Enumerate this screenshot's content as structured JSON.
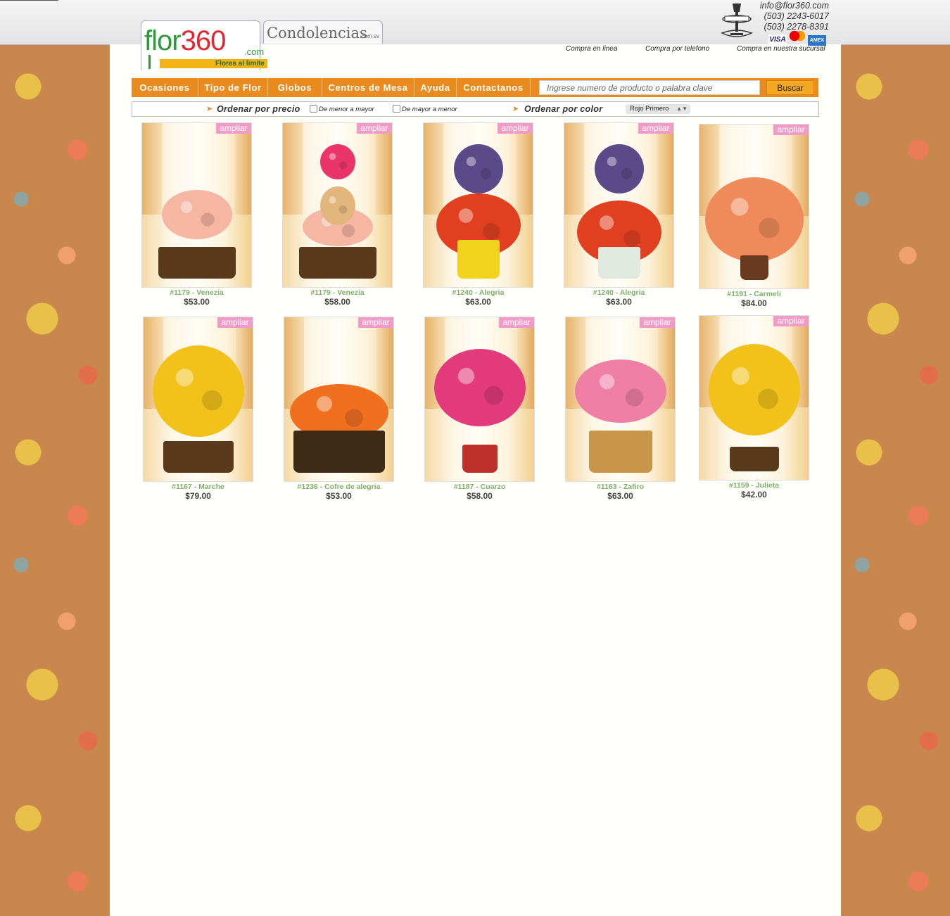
{
  "header": {
    "logo": {
      "brand_part1": "flor",
      "brand_part2": "360",
      "domain": ".com",
      "tagline": "Flores al limite"
    },
    "condolencias": {
      "name": "Condolencias",
      "domain": ".com.sv"
    },
    "contact": {
      "email": "info@flor360.com",
      "phone1": "(503) 2243-6017",
      "phone2": "(503) 2278-8391"
    },
    "cards": [
      "VISA",
      "MasterCard",
      "AMEX"
    ],
    "store_logo_icon": "la-gran-via-lamp-icon",
    "buy_links": [
      "Compra en linea",
      "Compra por telefono",
      "Compra en nuestra sucursal"
    ]
  },
  "nav": {
    "items": [
      "Ocasiones",
      "Tipo de Flor",
      "Globos",
      "Centros de Mesa",
      "Ayuda",
      "Contactanos"
    ],
    "search_placeholder": "Ingrese numero de producto o palabra clave",
    "search_button": "Buscar"
  },
  "sort": {
    "price_label": "Ordenar por precio",
    "option_low_high": "De menor a mayor",
    "option_high_low": "De mayor a menor",
    "color_label": "Ordenar por color",
    "color_selected": "Rojo Primero"
  },
  "colors": {
    "nav": "#e98b1e",
    "ampliar": "#f29bc6",
    "product_name": "#7fb06a"
  },
  "ampliar_label": "ampliar",
  "products": [
    {
      "name": "#1179 - Venezia",
      "price": "$53.00"
    },
    {
      "name": "#1179 - Venezia",
      "price": "$58.00"
    },
    {
      "name": "#1240 - Alegria",
      "price": "$63.00"
    },
    {
      "name": "#1240 - Alegria",
      "price": "$63.00"
    },
    {
      "name": "#1191 - Carmeli",
      "price": "$84.00"
    },
    {
      "name": "#1167 - Marche",
      "price": "$79.00"
    },
    {
      "name": "#1236 - Cofre de alegria",
      "price": "$53.00"
    },
    {
      "name": "#1187 - Cuarzo",
      "price": "$58.00"
    },
    {
      "name": "#1163 - Zafiro",
      "price": "$63.00"
    },
    {
      "name": "#1159 - Julieta",
      "price": "$42.00"
    }
  ]
}
